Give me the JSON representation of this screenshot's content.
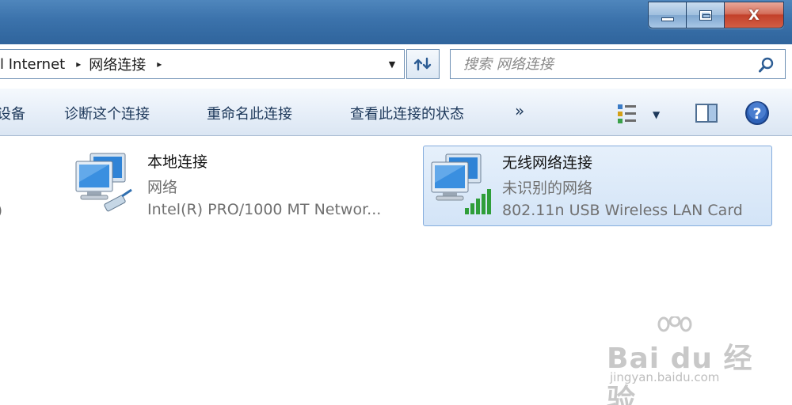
{
  "window": {
    "minimize_icon": "minimize-icon",
    "maximize_icon": "maximize-icon",
    "close_glyph": "X",
    "titlebar_color": "#3b72ab"
  },
  "address": {
    "crumbs": [
      "l Internet",
      "网络连接"
    ],
    "separator": "▸",
    "dropdown_glyph": "▼"
  },
  "search": {
    "placeholder": "搜索 网络连接"
  },
  "toolbar": {
    "items": [
      "设备",
      "诊断这个连接",
      "重命名此连接",
      "查看此连接的状态"
    ],
    "more": "»",
    "view_dropdown": "▼"
  },
  "content": {
    "cut_text": ")",
    "connections": [
      {
        "name": "本地连接",
        "status": "网络",
        "device": "Intel(R) PRO/1000 MT Networ...",
        "selected": false
      },
      {
        "name": "无线网络连接",
        "status": "未识别的网络",
        "device": "802.11n USB Wireless LAN Card",
        "selected": true
      }
    ]
  },
  "watermark": {
    "brand": "Bai du 经验",
    "url": "jingyan.baidu.com"
  },
  "colors": {
    "accent": "#1e395b",
    "selection": "#d3e4f7",
    "signal": "#2f9e3a"
  }
}
